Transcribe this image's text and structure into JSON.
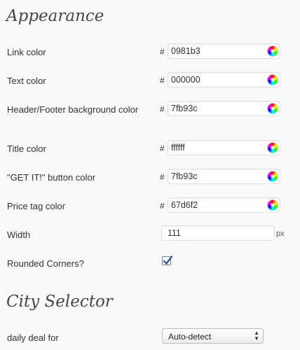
{
  "appearance": {
    "title": "Appearance",
    "rows": [
      {
        "label": "Link color",
        "hash": "#",
        "value": "0981b3"
      },
      {
        "label": "Text color",
        "hash": "#",
        "value": "000000"
      },
      {
        "label": "Header/Footer background color",
        "hash": "#",
        "value": "7fb93c"
      },
      {
        "label": "Title color",
        "hash": "#",
        "value": "ffffff"
      },
      {
        "label": "\"GET IT!\" button color",
        "hash": "#",
        "value": "7fb93c"
      },
      {
        "label": "Price tag color",
        "hash": "#",
        "value": "67d6f2"
      }
    ],
    "width": {
      "label": "Width",
      "value": "111",
      "unit": "px"
    },
    "rounded": {
      "label": "Rounded Corners?",
      "checked": true
    }
  },
  "city_selector": {
    "title": "City Selector",
    "daily_deal": {
      "label": "daily deal for",
      "selected": "Auto-detect"
    }
  },
  "icons": {
    "color_picker": "color-wheel-icon",
    "select_arrows": "up-down-arrows-icon",
    "checkmark": "checkmark-icon"
  },
  "colors": {
    "background": "#f9f9f9",
    "heading": "#464646",
    "checkmark": "#2b5aa0"
  }
}
